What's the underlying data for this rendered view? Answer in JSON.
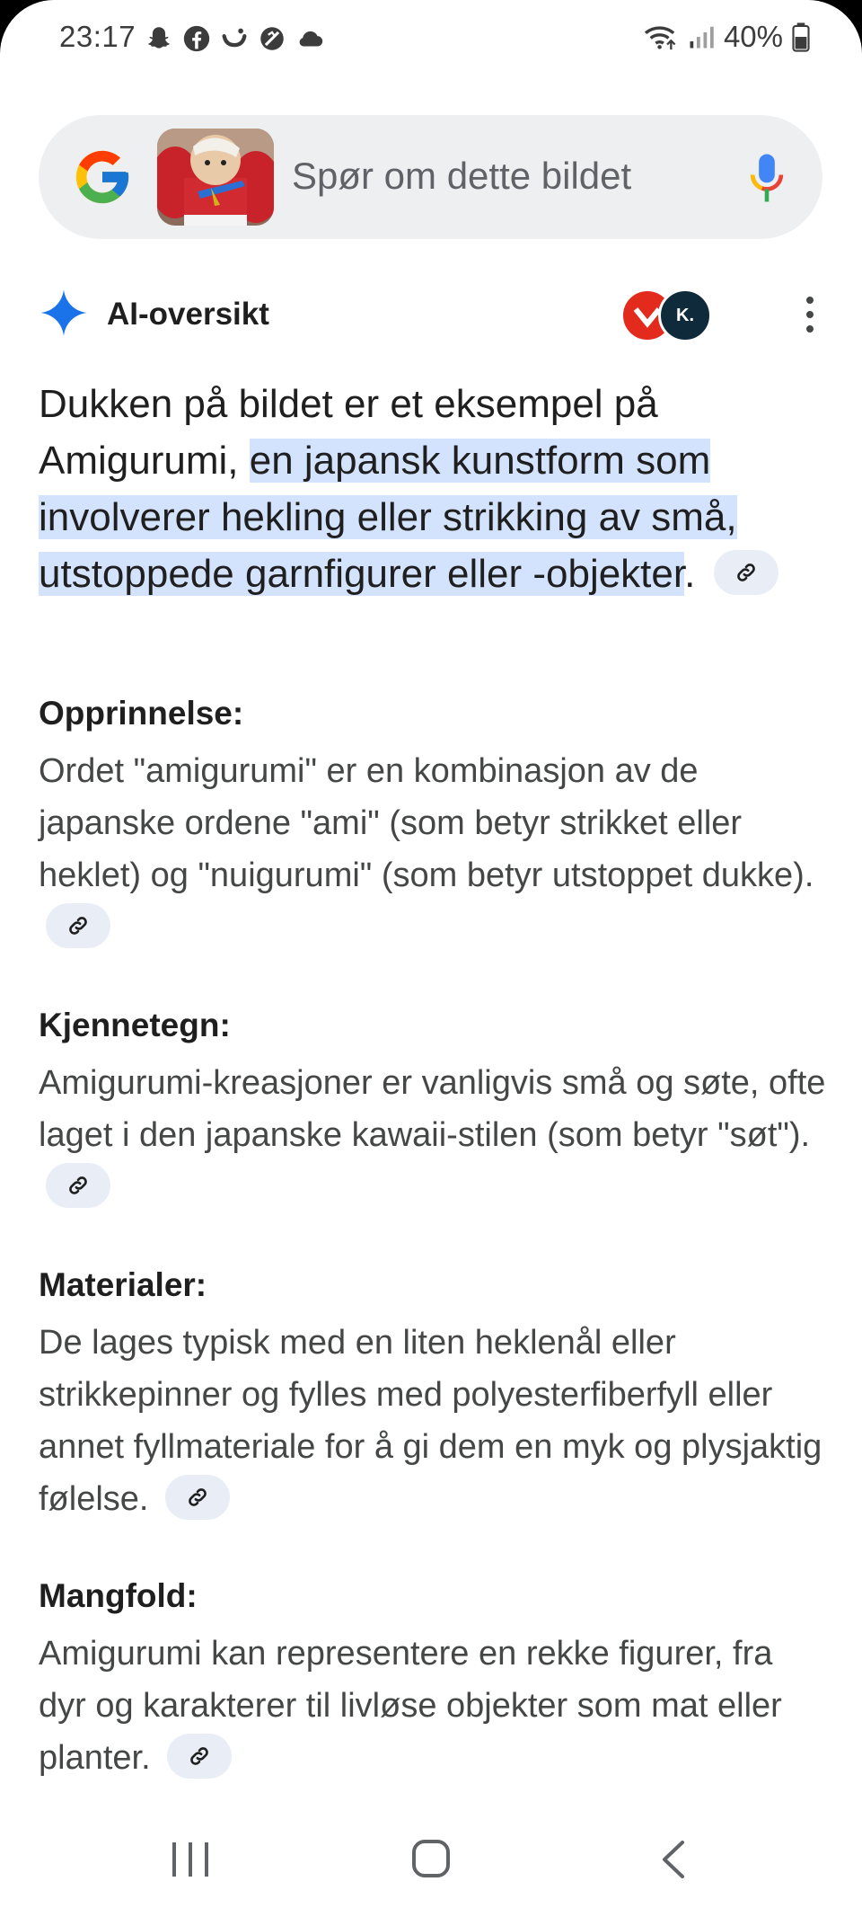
{
  "status_bar": {
    "time": "23:17",
    "battery": "40%",
    "left_icons": [
      "snapchat-icon",
      "facebook-icon",
      "smile-icon",
      "blocked-icon",
      "cloud-icon"
    ],
    "right_icons": [
      "wifi-icon",
      "signal-icon",
      "battery-icon"
    ]
  },
  "search": {
    "placeholder": "Spør om dette bildet",
    "logo": "google-logo-icon",
    "mic": "mic-icon"
  },
  "ai": {
    "title": "AI-oversikt",
    "lead_plain": "Dukken på bildet er et eksempel på Amigurumi, ",
    "lead_highlight": "en japansk kunstform som involverer hekling eller strikking av små, utstoppede garnfigurer eller -objekter",
    "lead_end": ".",
    "sources": [
      "source-avatar-red",
      "source-avatar-dark"
    ],
    "source_dark_text": "K."
  },
  "sections": [
    {
      "title": "Opprinnelse:",
      "body": "Ordet \"amigurumi\" er en kombinasjon av de japanske ordene \"ami\" (som betyr strikket eller heklet) og \"nuigurumi\" (som betyr utstoppet dukke)."
    },
    {
      "title": "Kjennetegn:",
      "body": "Amigurumi-kreasjoner er vanligvis små og søte, ofte laget i den japanske kawaii-stilen (som betyr \"søt\")."
    },
    {
      "title": "Materialer:",
      "body": "De lages typisk med en liten heklenål eller strikkepinner og fylles med polyesterfiberfyll eller annet fyllmateriale for å gi dem en myk og plysjaktig følelse."
    },
    {
      "title": "Mangfold:",
      "body": "Amigurumi kan representere en rekke figurer, fra dyr og karakterer til livløse objekter som mat eller planter."
    }
  ],
  "colors": {
    "highlight": "#d3e3fd",
    "chip": "#e9eef6",
    "search_bg": "#eeeff1",
    "gemini_blue": "#1a73e8"
  },
  "nav": [
    "recent-apps-icon",
    "home-icon",
    "back-icon"
  ]
}
